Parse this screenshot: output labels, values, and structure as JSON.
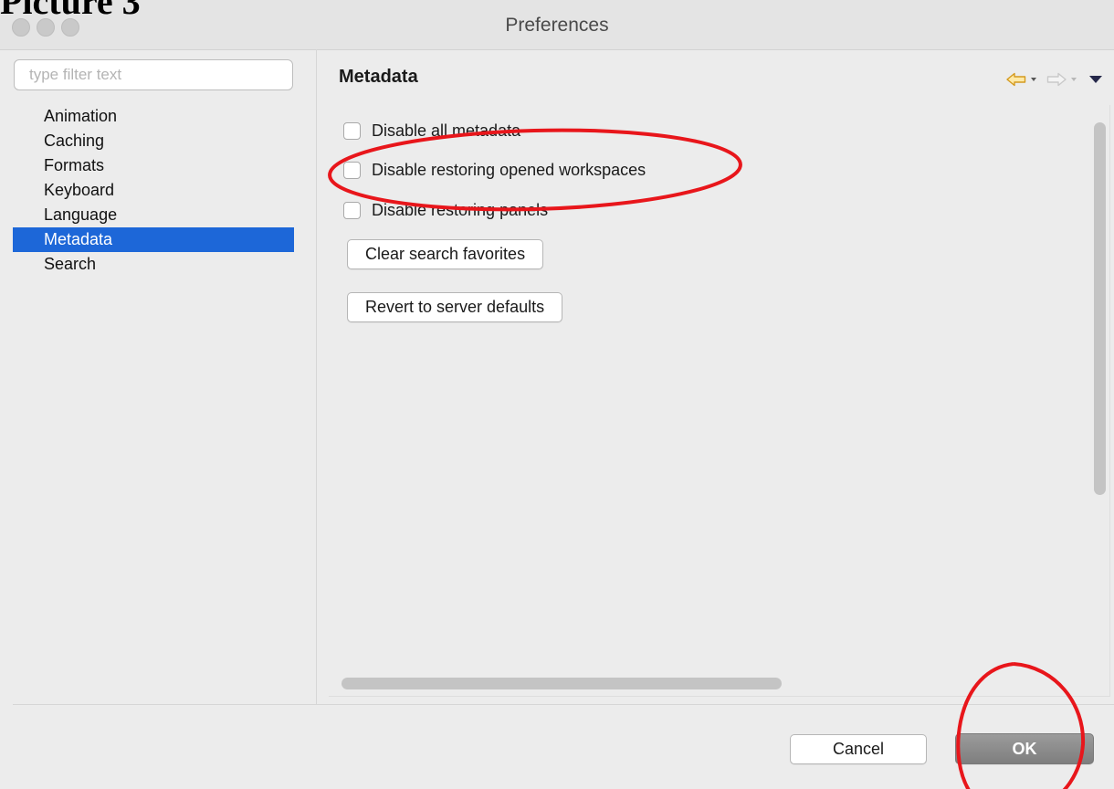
{
  "caption": "Picture 3",
  "window": {
    "title": "Preferences"
  },
  "sidebar": {
    "filter_placeholder": "type filter text",
    "items": [
      {
        "label": "Animation",
        "selected": false
      },
      {
        "label": "Caching",
        "selected": false
      },
      {
        "label": "Formats",
        "selected": false
      },
      {
        "label": "Keyboard",
        "selected": false
      },
      {
        "label": "Language",
        "selected": false
      },
      {
        "label": "Metadata",
        "selected": true
      },
      {
        "label": "Search",
        "selected": false
      }
    ]
  },
  "page": {
    "title": "Metadata",
    "toolbar_icons": [
      "back-arrow-icon",
      "back-menu-icon",
      "forward-arrow-icon",
      "forward-menu-icon",
      "view-menu-icon"
    ],
    "options": [
      {
        "label": "Disable all metadata",
        "checked": false
      },
      {
        "label": "Disable restoring opened workspaces",
        "checked": false
      },
      {
        "label": "Disable restoring panels",
        "checked": false
      }
    ],
    "buttons": {
      "clear_favorites": "Clear search favorites",
      "revert_defaults": "Revert to server defaults"
    }
  },
  "footer": {
    "cancel_label": "Cancel",
    "ok_label": "OK"
  },
  "colors": {
    "selection": "#1d67d8",
    "annotation": "#e8161b",
    "back_arrow": "#e0a324"
  }
}
